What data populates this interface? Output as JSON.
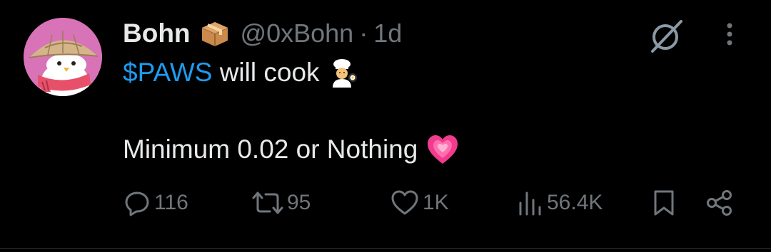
{
  "tweet": {
    "author_name": "Bohn",
    "handle": "@0xBohn",
    "separator": "·",
    "time": "1d",
    "cashtag": "$PAWS",
    "line1_rest": " will cook",
    "line2": "Minimum 0.02 or Nothing"
  },
  "icons": {
    "author_badge": "package-emoji",
    "line1_emoji": "cook-emoji",
    "line2_emoji": "sparkling-heart-emoji",
    "grok": "grok-icon",
    "more": "more-vertical-icon"
  },
  "actions": {
    "replies": "116",
    "reposts": "95",
    "likes": "1K",
    "views": "56.4K"
  },
  "colors": {
    "background": "#000000",
    "text": "#e7e9ea",
    "muted": "#71767b",
    "link": "#1d9bf0",
    "heart": "#f23b8f"
  }
}
